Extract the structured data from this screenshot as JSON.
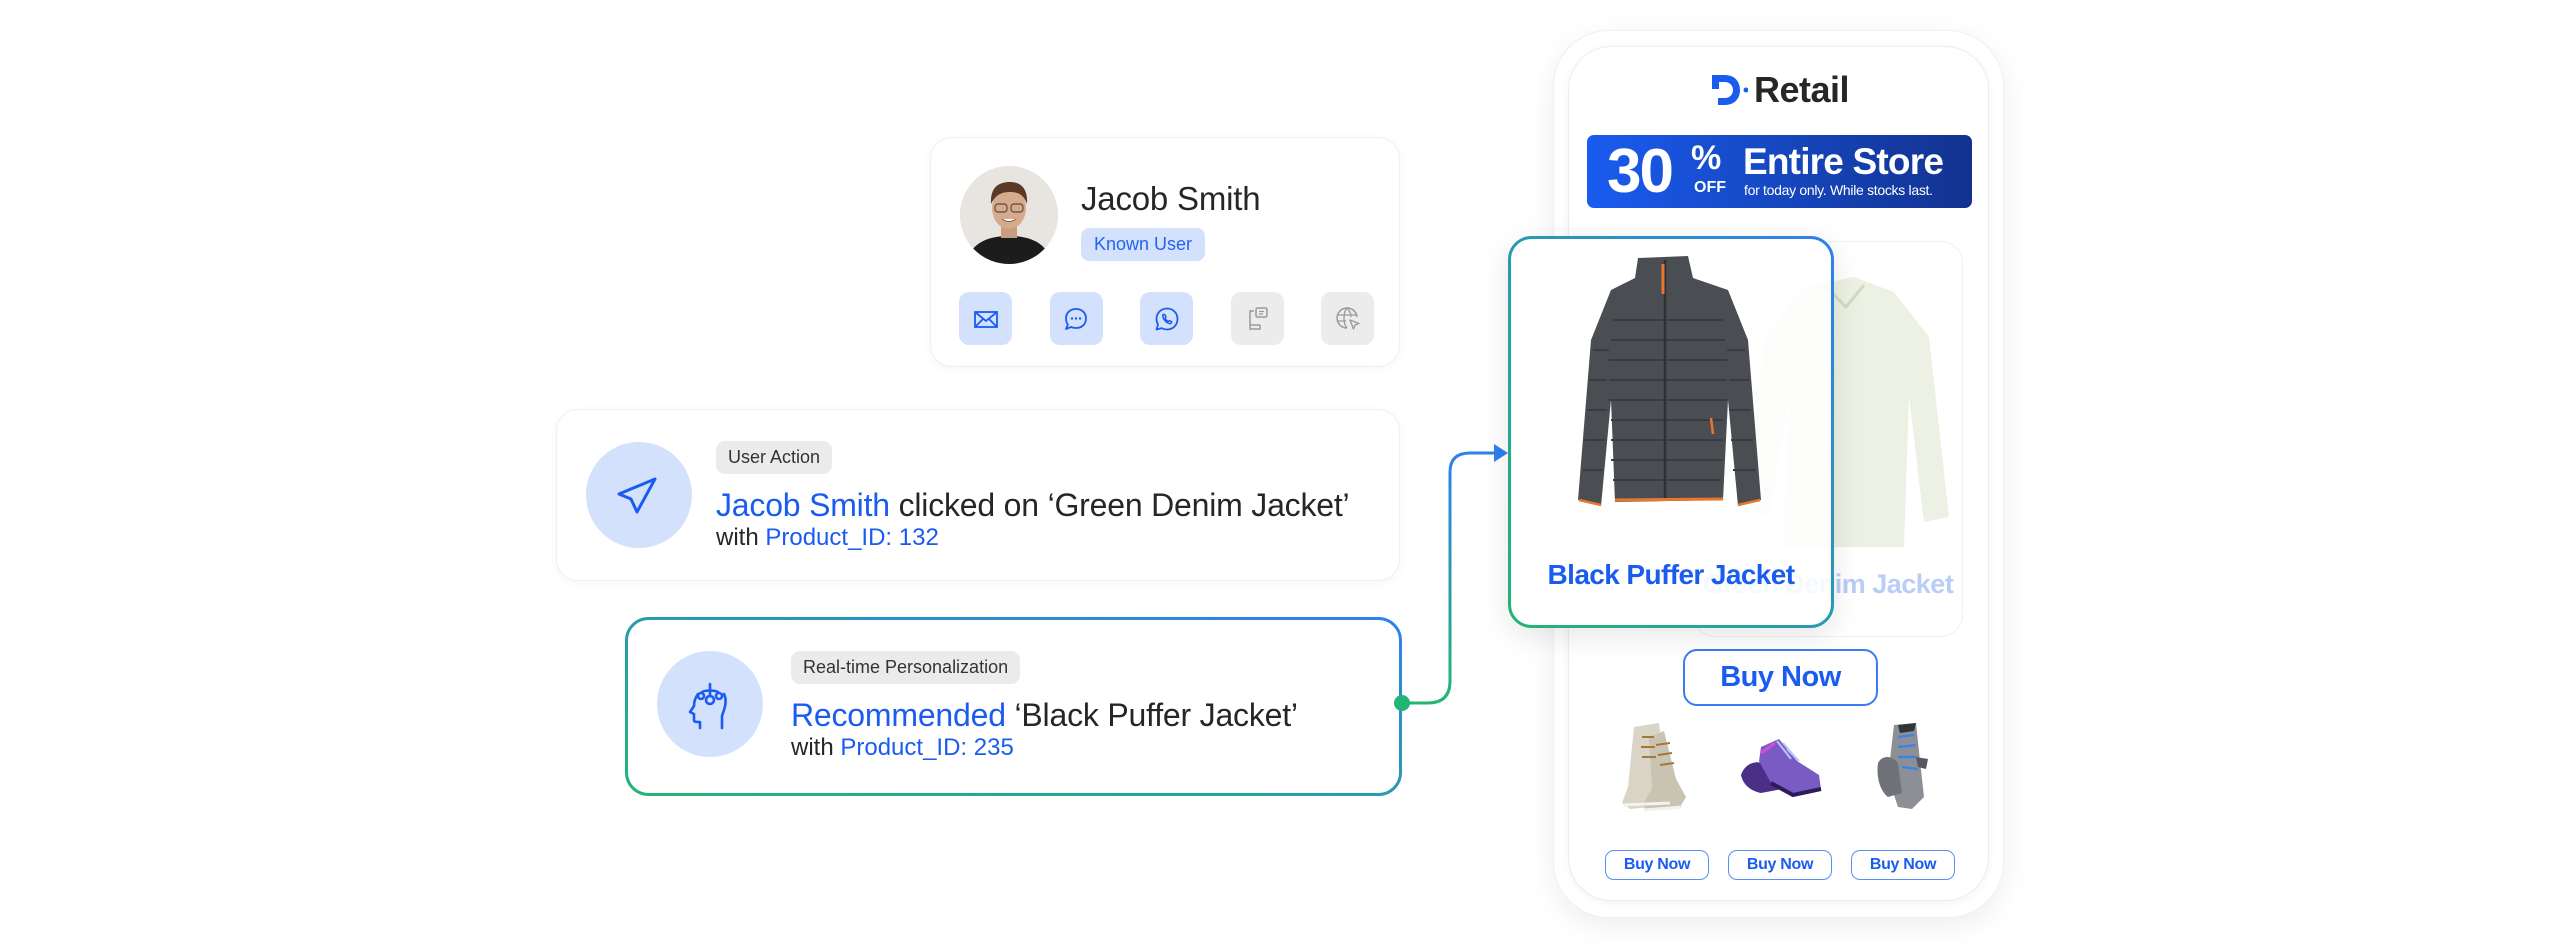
{
  "profile": {
    "name": "Jacob Smith",
    "badge": "Known User",
    "avatar_icon": "user-photo",
    "channels": [
      {
        "name": "email",
        "icon": "envelope-icon",
        "active": true
      },
      {
        "name": "chat",
        "icon": "chat-bubble-icon",
        "active": true
      },
      {
        "name": "whatsapp",
        "icon": "whatsapp-icon",
        "active": true
      },
      {
        "name": "in-app",
        "icon": "mobile-message-icon",
        "active": false
      },
      {
        "name": "web",
        "icon": "globe-cursor-icon",
        "active": false
      }
    ]
  },
  "user_action": {
    "tag": "User Action",
    "icon": "navigation-arrow-icon",
    "actor": "Jacob Smith",
    "action_text": " clicked on ‘Green Denim Jacket’",
    "with_prefix": "with ",
    "product_id": "Product_ID: 132"
  },
  "personalization": {
    "tag": "Real-time Personalization",
    "icon": "brain-head-icon",
    "verb": "Recommended",
    "item_text": " ‘Black Puffer Jacket’",
    "with_prefix": "with ",
    "product_id": "Product_ID: 235"
  },
  "phone": {
    "brand": "Retail",
    "promo": {
      "amount": "30",
      "percent": "%",
      "off": "OFF",
      "title": "Entire Store",
      "subtitle": "for today only. While stocks last."
    },
    "featured_product": "Black Puffer Jacket",
    "previous_product": "Green Denim Jacket",
    "main_button": "Buy Now",
    "shoes": [
      {
        "name": "beige-high-top-sneaker",
        "button": "Buy Now"
      },
      {
        "name": "purple-sneaker",
        "button": "Buy Now"
      },
      {
        "name": "grey-running-shoe",
        "button": "Buy Now"
      }
    ]
  },
  "colors": {
    "accent_blue": "#1a5cf0",
    "light_blue": "#d3e1fc",
    "connector_green": "#22b573",
    "promo_gradient_end": "#12328f"
  }
}
